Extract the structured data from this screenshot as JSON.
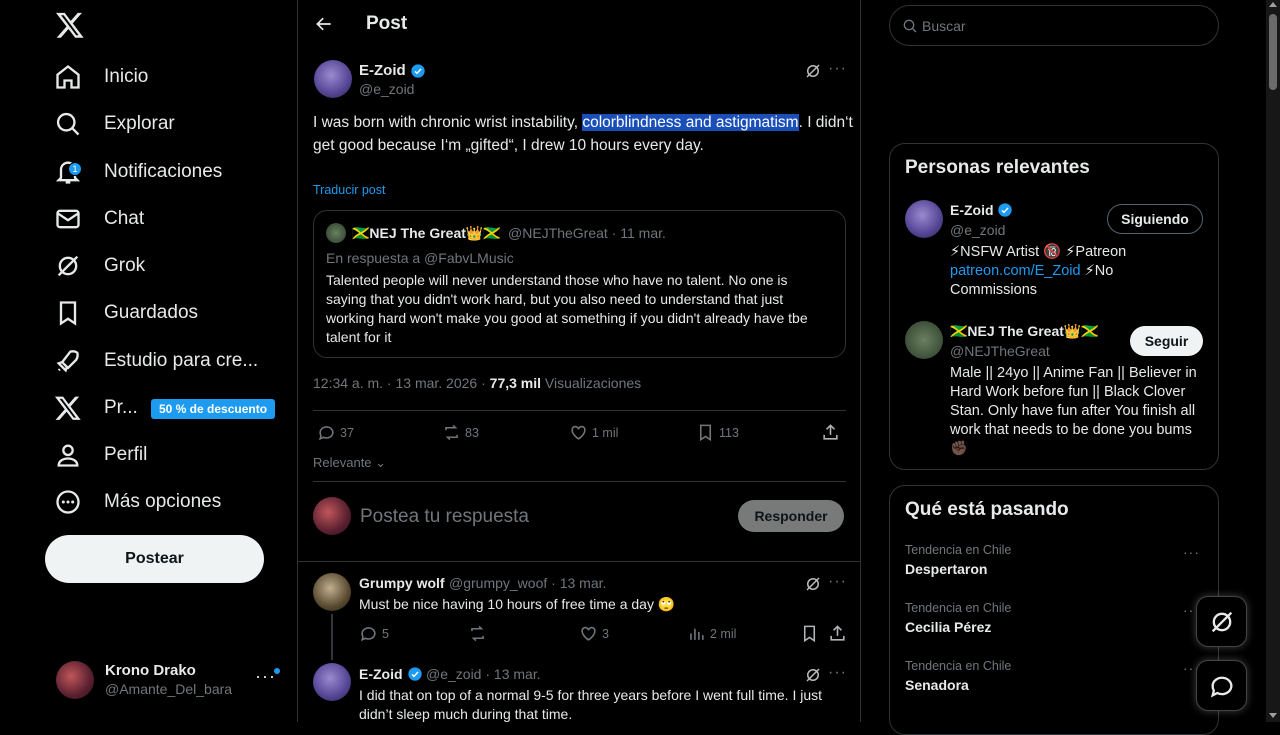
{
  "sidebar": {
    "logo": "x-logo-icon",
    "nav": [
      {
        "label": "Inicio",
        "icon": "home-icon"
      },
      {
        "label": "Explorar",
        "icon": "search-icon"
      },
      {
        "label": "Notificaciones",
        "icon": "bell-icon",
        "badge": "1"
      },
      {
        "label": "Chat",
        "icon": "mail-icon"
      },
      {
        "label": "Grok",
        "icon": "grok-icon"
      },
      {
        "label": "Guardados",
        "icon": "bookmark-icon"
      },
      {
        "label": "Estudio para cre...",
        "icon": "rocket-icon"
      },
      {
        "label": "Pr...",
        "icon": "x-premium-icon",
        "promo": "50 % de descuento"
      },
      {
        "label": "Perfil",
        "icon": "person-icon"
      },
      {
        "label": "Más opciones",
        "icon": "more-circle-icon"
      }
    ],
    "post_button": "Postear",
    "account": {
      "name": "Krono Drako",
      "handle": "@Amante_Del_bara",
      "more": "···"
    }
  },
  "main": {
    "header_title": "Post",
    "post": {
      "author_name": "E-Zoid",
      "author_handle": "@e_zoid",
      "text_before": "I was  born with chronic wrist instability, ",
      "text_highlight": "colorblindness and astigmatism",
      "text_after": ". I didn‘t get good because I‘m „gifted“, I drew 10 hours every day.",
      "translate": "Traducir post",
      "more": "···",
      "quote": {
        "name": "🇯🇲NEJ The Great👑🇯🇲",
        "handle": "@NEJTheGreat · 11 mar.",
        "reply_to": "En respuesta a @FabvLMusic",
        "text": "Talented people will never understand those who have no talent. No one is saying that you didn't work hard, but you also need to understand that just working hard won't make you good at something if you didn't already have tbe talent for it"
      },
      "time": "12:34 a. m. · 13 mar. 2026 · ",
      "views_count": "77,3 mil",
      "views_label": " Visualizaciones",
      "stats": {
        "replies": "37",
        "reposts": "83",
        "likes": "1 mil",
        "bookmarks": "113"
      }
    },
    "relevance": "Relevante",
    "reply_placeholder": "Postea tu respuesta",
    "reply_button": "Responder",
    "replies": [
      {
        "name": "Grumpy wolf",
        "meta": "@grumpy_woof · 13 mar.",
        "text": "Must be nice having 10 hours of free time a day 🙄",
        "stats": {
          "replies": "5",
          "likes": "3",
          "views": "2 mil"
        }
      },
      {
        "name": "E-Zoid",
        "meta": "@e_zoid · 13 mar.",
        "text": "I did that on top of a normal 9-5 for three years before I went full time. I just didn’t sleep much during that time."
      }
    ]
  },
  "right": {
    "search_placeholder": "Buscar",
    "people_title": "Personas relevantes",
    "people": [
      {
        "name": "E-Zoid",
        "handle": "@e_zoid",
        "button": "Siguiendo",
        "bio_1": "⚡NSFW Artist 🔞 ⚡Patreon",
        "bio_link": "patreon.com/E_Zoid",
        "bio_2": " ⚡No",
        "bio_3": "Commissions"
      },
      {
        "name": "🇯🇲NEJ The Great👑🇯🇲",
        "handle": "@NEJTheGreat",
        "button": "Seguir",
        "bio": "Male || 24yo || Anime Fan || Believer in Hard Work before fun || Black Clover Stan. Only have fun after You finish all work that needs to be done you bums ✊🏿"
      }
    ],
    "trends_title": "Qué está pasando",
    "trends": [
      {
        "category": "Tendencia en Chile",
        "name": "Despertaron"
      },
      {
        "category": "Tendencia en Chile",
        "name": "Cecilia Pérez"
      },
      {
        "category": "Tendencia en Chile",
        "name": "Senadora"
      }
    ],
    "trend_more": "···"
  },
  "colors": {
    "accent": "#1d9bf0",
    "background": "#000000",
    "border": "#2f3336",
    "muted": "#71767b",
    "highlight": "#1a4fba"
  }
}
